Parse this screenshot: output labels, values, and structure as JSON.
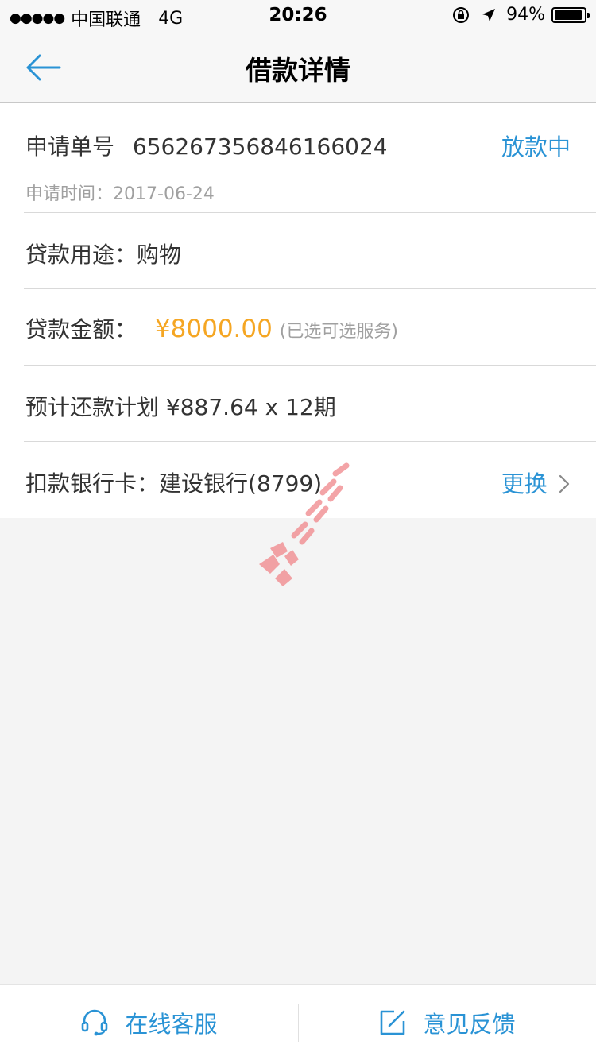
{
  "status_bar": {
    "signal": "●●●●●",
    "carrier": "中国联通",
    "network": "4G",
    "time": "20:26",
    "battery_percent": "94%",
    "battery_level": 0.94
  },
  "nav": {
    "title": "借款详情",
    "back_icon": "arrow-left-icon"
  },
  "detail": {
    "application_no_label": "申请单号",
    "application_no": "656267356846166024",
    "status": "放款中",
    "apply_time_label": "申请时间：",
    "apply_time": "2017-06-24",
    "purpose_label": "贷款用途：",
    "purpose": "购物",
    "amount_label": "贷款金额：",
    "amount": "¥8000.00",
    "amount_note": "(已选可选服务)",
    "plan_label": "预计还款计划",
    "plan_value": "¥887.64 x 12期",
    "bank_label": "扣款银行卡：",
    "bank_value": "建设银行(8799)",
    "change_label": "更换"
  },
  "bottom": {
    "service_label": "在线客服",
    "feedback_label": "意见反馈"
  },
  "colors": {
    "accent": "#2a93d5",
    "amount": "#f5a623",
    "watermark": "#f0868a"
  }
}
